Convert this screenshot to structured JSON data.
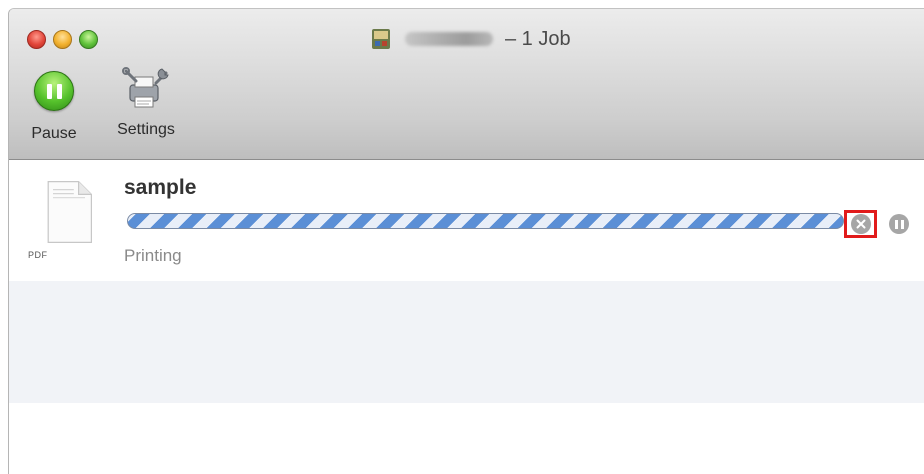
{
  "window": {
    "title": "– 1 Job"
  },
  "toolbar": {
    "pause_label": "Pause",
    "settings_label": "Settings"
  },
  "job": {
    "name": "sample",
    "file_type": "PDF",
    "status": "Printing",
    "progress": "indeterminate"
  },
  "icons": {
    "app": "printer-app-icon",
    "pause": "pause-icon",
    "settings": "printer-settings-icon",
    "document": "pdf-document-icon",
    "cancel": "cancel-job-icon",
    "hold": "pause-job-icon"
  },
  "colors": {
    "pause_green": "#56c22c",
    "progress_blue": "#5b8fd6",
    "highlight_red": "#e11b1b",
    "status_gray": "#8a8a8a"
  }
}
